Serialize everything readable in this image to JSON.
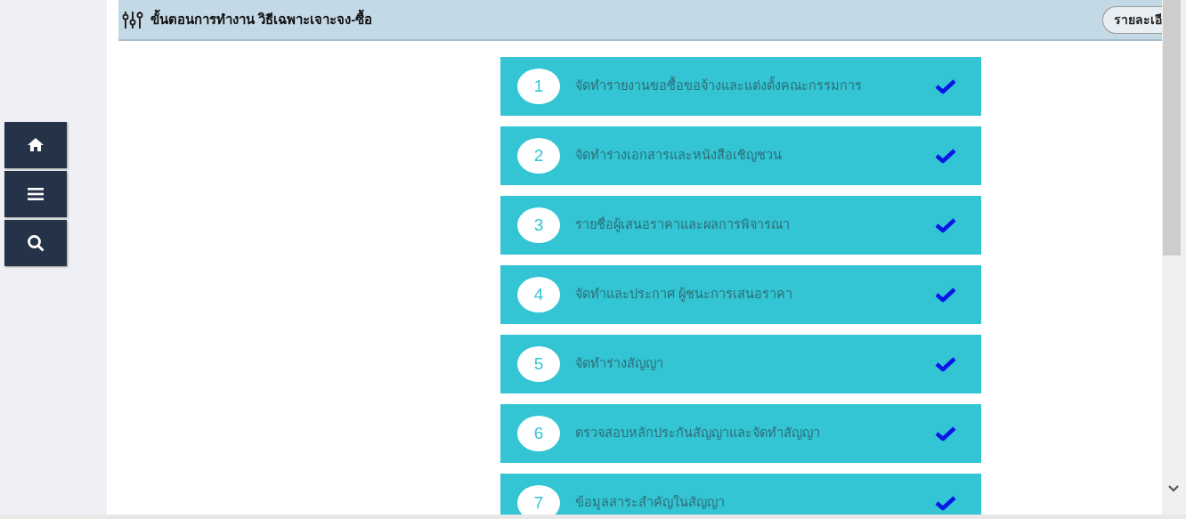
{
  "header": {
    "title": "ขั้นตอนการทำงาน วิธีเฉพาะเจาะจง-ซื้อ",
    "detail_button": "รายละเอี"
  },
  "sidebar": {
    "items": [
      {
        "kind": "home"
      },
      {
        "kind": "menu"
      },
      {
        "kind": "search"
      }
    ]
  },
  "steps": [
    {
      "number": "1",
      "label": "จัดทำรายงานขอซื้อขอจ้างและแต่งตั้งคณะกรรมการ",
      "done": true
    },
    {
      "number": "2",
      "label": "จัดทำร่างเอกสารและหนังสือเชิญชวน",
      "done": true
    },
    {
      "number": "3",
      "label": "รายชื่อผู้เสนอราคาและผลการพิจารณา",
      "done": true
    },
    {
      "number": "4",
      "label": "จัดทำและประกาศ ผู้ชนะการเสนอราคา",
      "done": true
    },
    {
      "number": "5",
      "label": "จัดทำร่างสัญญา",
      "done": true
    },
    {
      "number": "6",
      "label": "ตรวจสอบหลักประกันสัญญาและจัดทำสัญญา",
      "done": true
    },
    {
      "number": "7",
      "label": "ข้อมูลสาระสำคัญในสัญญา",
      "done": true
    }
  ]
}
